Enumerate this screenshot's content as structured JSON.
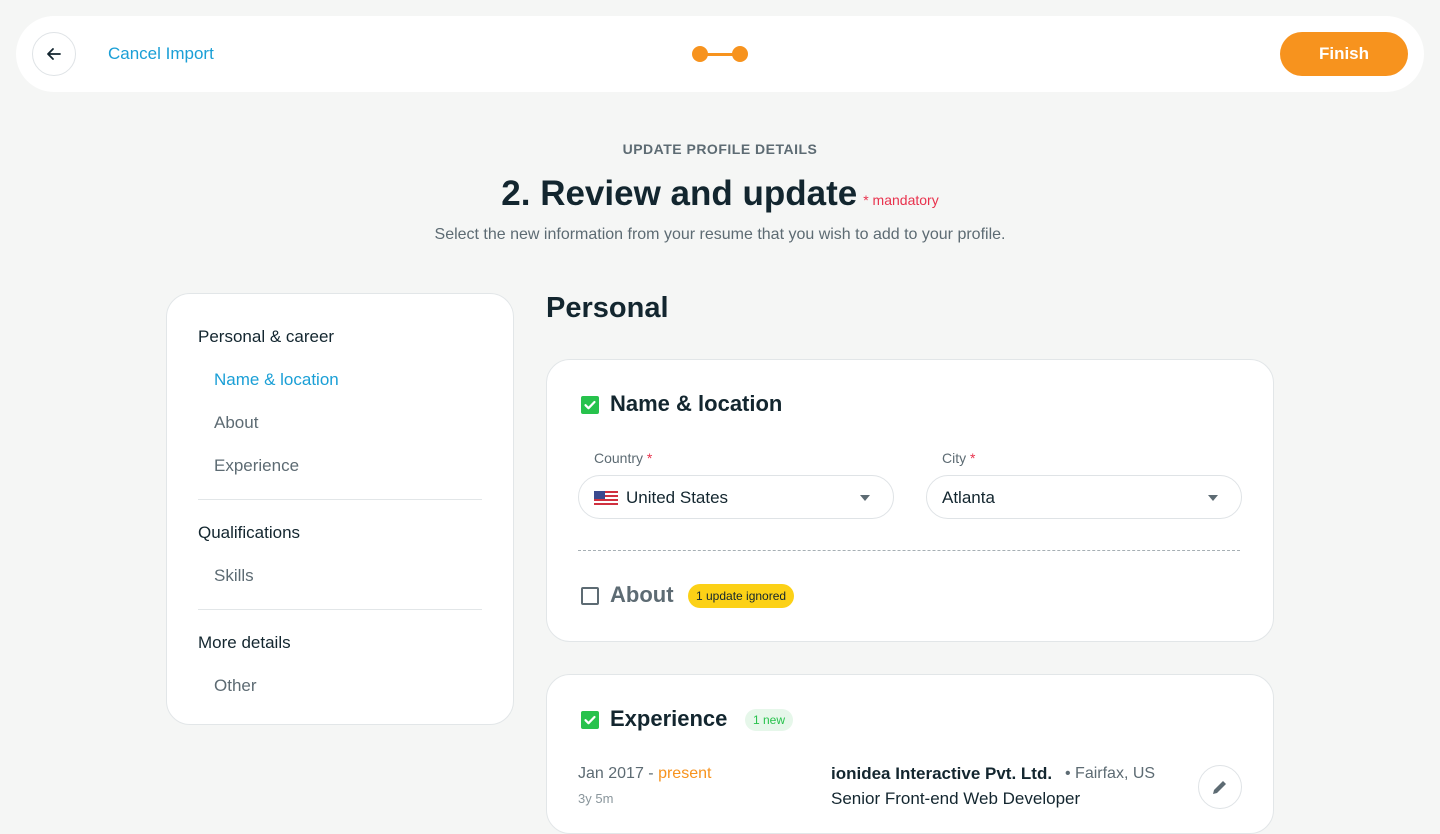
{
  "header": {
    "cancel_label": "Cancel Import",
    "finish_label": "Finish",
    "accent_color": "#f7931e",
    "link_color": "#1a9fd6"
  },
  "intro": {
    "eyebrow": "UPDATE PROFILE DETAILS",
    "title": "2. Review and update",
    "mandatory_note": "* mandatory",
    "subtitle": "Select the new information from your resume that you wish to add to your profile."
  },
  "sidenav": {
    "groups": [
      {
        "label": "Personal & career",
        "items": [
          "Name & location",
          "About",
          "Experience"
        ]
      },
      {
        "label": "Qualifications",
        "items": [
          "Skills"
        ]
      },
      {
        "label": "More details",
        "items": [
          "Other"
        ]
      }
    ],
    "active_item": "Name & location"
  },
  "section": {
    "title": "Personal"
  },
  "name_location": {
    "heading": "Name & location",
    "checked": true,
    "country": {
      "label": "Country",
      "required_mark": "*",
      "value": "United States",
      "flag": "us-flag-icon"
    },
    "city": {
      "label": "City",
      "required_mark": "*",
      "value": "Atlanta"
    }
  },
  "about": {
    "heading": "About",
    "checked": false,
    "badge": "1 update ignored"
  },
  "experience": {
    "heading": "Experience",
    "checked": true,
    "badge": "1 new",
    "entry": {
      "start": "Jan 2017",
      "separator": " - ",
      "end": "present",
      "duration": "3y 5m",
      "company": "ionidea Interactive Pvt. Ltd.",
      "location": "• Fairfax, US",
      "role": "Senior Front-end Web Developer"
    }
  }
}
